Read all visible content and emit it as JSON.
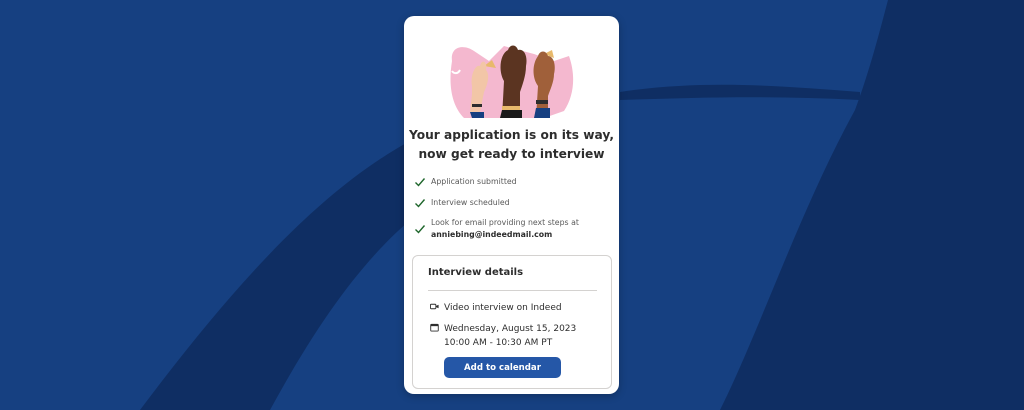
{
  "colors": {
    "background": "#164081",
    "background_dark": "#0f2e63",
    "card": "#ffffff",
    "check": "#1f662c",
    "button": "#2557a7"
  },
  "hero": {
    "icon": "raised-hands-illustration"
  },
  "title": {
    "line1": "Your application is on its way,",
    "line2": "now get ready to interview"
  },
  "checklist": [
    {
      "icon": "check-icon",
      "text": "Application submitted"
    },
    {
      "icon": "check-icon",
      "text": "Interview scheduled"
    },
    {
      "icon": "check-icon",
      "text": "Look for email providing next steps at",
      "email": "anniebing@indeedmail.com"
    }
  ],
  "interview_details": {
    "title": "Interview details",
    "type": {
      "icon": "video-camera-icon",
      "text": "Video interview on Indeed"
    },
    "datetime": {
      "icon": "calendar-icon",
      "date": "Wednesday, August 15, 2023",
      "time": "10:00 AM - 10:30 AM PT"
    },
    "button_label": "Add to calendar"
  }
}
